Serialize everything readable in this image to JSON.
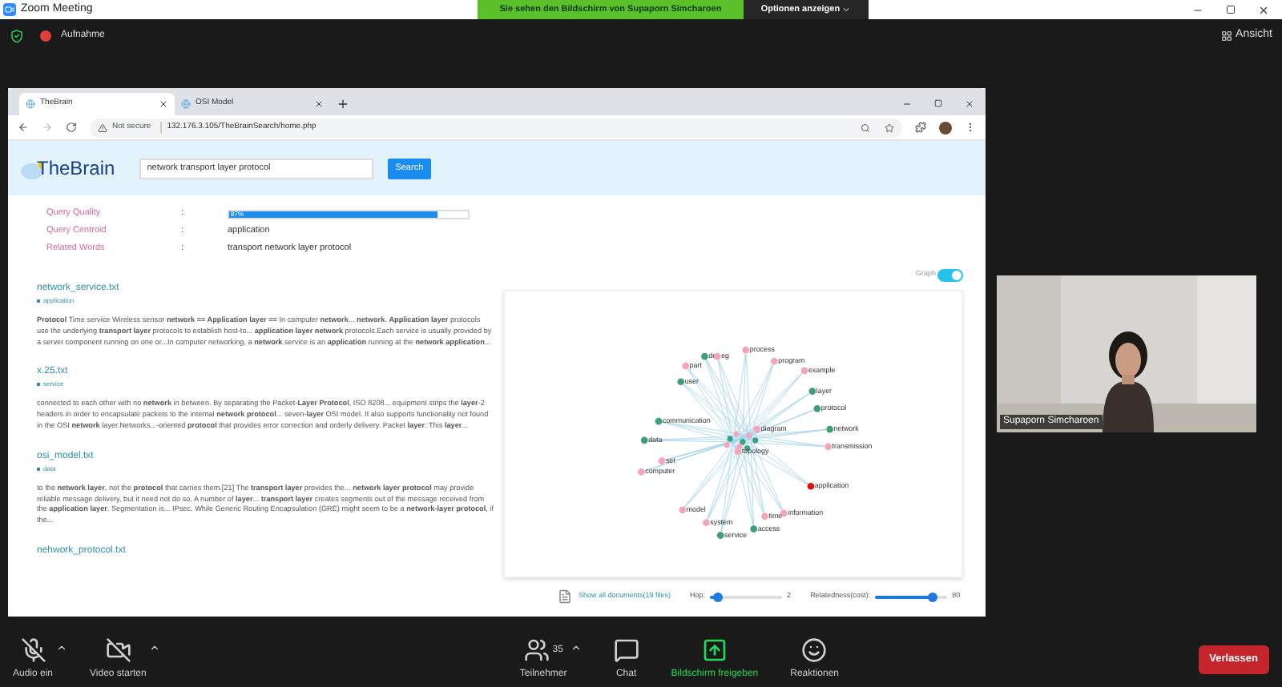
{
  "zoom": {
    "title": "Zoom Meeting",
    "share_banner": "Sie sehen den Bildschirm von Supaporn Simcharoen",
    "options_button": "Optionen anzeigen",
    "recording": "Aufnahme",
    "view_button": "Ansicht"
  },
  "browser": {
    "tabs": [
      {
        "label": "TheBrain",
        "selected": true
      },
      {
        "label": "OSI Model",
        "selected": false
      }
    ],
    "security": "Not secure",
    "url": "132.176.3.105/TheBrainSearch/home.php"
  },
  "app": {
    "logo": "TheBrain",
    "search": {
      "value": "network transport layer protocol"
    },
    "search_button": "Search",
    "query": [
      {
        "label": "Query Quality",
        "separator": ":",
        "kind": "meter",
        "level": 0.87,
        "reading": "87%"
      },
      {
        "label": "Query Centroid",
        "separator": ":",
        "kind": "text",
        "value": "application"
      },
      {
        "label": "Related Words",
        "separator": ":",
        "kind": "text",
        "value": "transport network layer protocol"
      }
    ],
    "results": [
      {
        "file": "network_service.txt",
        "tag": "application",
        "snippet": "**Protocol** Time service Wireless sensor **network == Application layer ==** In computer **network**... **network**. **Application layer** protocols use the underlying **transport layer** protocols to establish host-to... **application layer network** protocols.Each service is usually provided by a server component running on one or...In computer networking, a **network** service is an **application** running at the **network application**..."
      },
      {
        "file": "x.25.txt",
        "tag": "service",
        "snippet": "connected to each other with no **network** in between. By separating the Packet-**Layer Protocol**, ISO 8208... equipment strips the **layer**-2 headers in order to encapsulate packets to the internal **network protocol**... seven-**layer** OSI model. It also supports functionality not found in the OSI **network** layer.Networks...-oriented **protocol** that provides error correction and orderly delivery. Packet **layer**: This **layer**..."
      },
      {
        "file": "osi_model.txt",
        "tag": "data",
        "snippet": "to the **network layer**, not the **protocol** that carries them.[21] The **transport layer** provides the... **network layer protocol** may provide reliable message delivery, but it need not do so. A number of **layer**... **transport layer** creates segments out of the message received from the **application layer**. Segmentation is... IPsec. While Generic Routing Encapsulation (GRE) might seem to be a **network-layer protocol**, if the..."
      },
      {
        "file": "nehwork_protocol.txt"
      }
    ],
    "graph_toggle": {
      "label": "Graph",
      "on": true
    },
    "graph": {
      "nodes": [
        {
          "label": "process",
          "color": "#f4a6b8"
        },
        {
          "label": "de",
          "color": "#3f9e7c"
        },
        {
          "label": "eg",
          "color": "#f4a6b8"
        },
        {
          "label": "program",
          "color": "#f4a6b8"
        },
        {
          "label": "part",
          "color": "#f4a6b8"
        },
        {
          "label": "example",
          "color": "#f4a6b8"
        },
        {
          "label": "user",
          "color": "#3f9e7c"
        },
        {
          "label": "layer",
          "color": "#3f9e7c"
        },
        {
          "label": "protocol",
          "color": "#3f9e7c"
        },
        {
          "label": "communication",
          "color": "#3f9e7c"
        },
        {
          "label": "diagram",
          "color": "#f4a6b8"
        },
        {
          "label": "network",
          "color": "#3f9e7c"
        },
        {
          "label": "data",
          "color": "#3f9e7c"
        },
        {
          "label": "transmission",
          "color": "#f4a6b8"
        },
        {
          "label": "topology",
          "color": "#f4a6b8"
        },
        {
          "label": "set",
          "color": "#f4a6b8"
        },
        {
          "label": "computer",
          "color": "#f4a6b8"
        },
        {
          "label": "application",
          "color": "#e01010"
        },
        {
          "label": "model",
          "color": "#f4a6b8"
        },
        {
          "label": "information",
          "color": "#f4a6b8"
        },
        {
          "label": "time",
          "color": "#f4a6b8"
        },
        {
          "label": "system",
          "color": "#f4a6b8"
        },
        {
          "label": "access",
          "color": "#3f9e7c"
        },
        {
          "label": "service",
          "color": "#3f9e7c"
        }
      ]
    },
    "show_all": "Show all documents(19 files)",
    "sliders": [
      {
        "label": "Hop:",
        "level": 0.1,
        "reading": "2"
      },
      {
        "label": "Relatedness(cost):",
        "level": 0.8,
        "reading": "80"
      }
    ]
  },
  "participant": {
    "name": "Supaporn Simcharoen"
  },
  "toolbar": [
    {
      "label": "Audio ein",
      "kind": "mic",
      "caret": true
    },
    {
      "label": "Video starten",
      "kind": "video",
      "caret": true
    },
    {
      "label": "Teilnehmer",
      "kind": "participants",
      "count": "35",
      "caret": true
    },
    {
      "label": "Chat",
      "kind": "chat",
      "caret": false
    },
    {
      "label": "Bildschirm freigeben",
      "kind": "share",
      "caret": false
    },
    {
      "label": "Reaktionen",
      "kind": "reactions",
      "caret": false
    }
  ],
  "leave_button": "Verlassen"
}
